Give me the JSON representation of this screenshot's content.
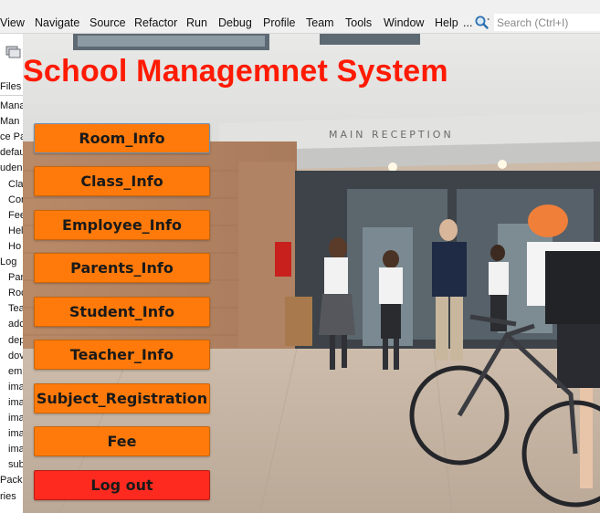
{
  "menubar": {
    "items": [
      "View",
      "Navigate",
      "Source",
      "Refactor",
      "Run",
      "Debug",
      "Profile",
      "Team",
      "Tools",
      "Window",
      "Help"
    ],
    "ellipsis": "...",
    "search_placeholder": "Search (Ctrl+I)"
  },
  "project_tree": {
    "header": "Files",
    "items": [
      "Mana",
      "Man",
      "ce Pa",
      "defau",
      "uden",
      "Cla",
      "Cor",
      "Fee",
      "Hel",
      "Ho",
      "Log",
      "Par",
      "Roc",
      "Tea",
      "adc",
      "dep",
      "dov",
      "em",
      "ima",
      "ima",
      "ima",
      "ima",
      "ima",
      "sub",
      "Packa",
      "ries"
    ]
  },
  "app": {
    "title": "School Managemnet System",
    "background_photo_text": "MAIN RECEPTION",
    "buttons": [
      {
        "label": "Room_Info"
      },
      {
        "label": "Class_Info"
      },
      {
        "label": "Employee_Info"
      },
      {
        "label": "Parents_Info"
      },
      {
        "label": "Student_Info"
      },
      {
        "label": "Teacher_Info"
      },
      {
        "label": "Subject_Registration"
      },
      {
        "label": "Fee"
      },
      {
        "label": "Log out"
      }
    ]
  },
  "colors": {
    "title": "#ff1a00",
    "button": "#ff7a0a",
    "logout_button": "#ff2a1f"
  }
}
